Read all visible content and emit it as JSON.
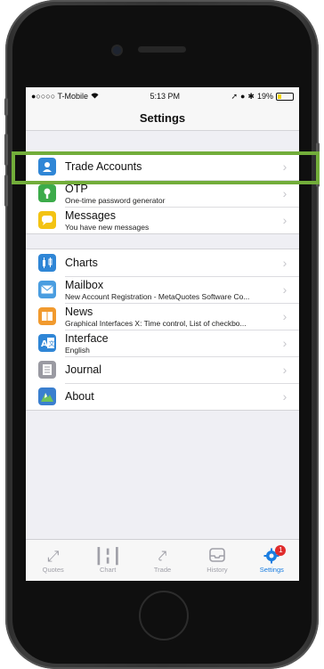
{
  "status": {
    "carrier": "●○○○○ T-Mobile",
    "wifi": "wifi-icon",
    "time": "5:13 PM",
    "battery_text": "19%"
  },
  "nav": {
    "title": "Settings"
  },
  "group1": [
    {
      "icon": "trade-accounts-icon",
      "color": "#2f86d6",
      "label": "Trade Accounts",
      "sub": ""
    }
  ],
  "group2": [
    {
      "icon": "otp-lock-icon",
      "color": "#3cab4a",
      "label": "OTP",
      "sub": "One-time password generator"
    },
    {
      "icon": "messages-icon",
      "color": "#f3c313",
      "label": "Messages",
      "sub": "You have new messages"
    }
  ],
  "group3": [
    {
      "icon": "charts-icon",
      "color": "#2f86d6",
      "label": "Charts",
      "sub": ""
    },
    {
      "icon": "mailbox-icon",
      "color": "#4a9de0",
      "label": "Mailbox",
      "sub": "New Account Registration - MetaQuotes Software Co..."
    },
    {
      "icon": "news-icon",
      "color": "#f19a2e",
      "label": "News",
      "sub": "Graphical Interfaces X: Time control, List of checkbo..."
    },
    {
      "icon": "interface-language-icon",
      "color": "#2f86d6",
      "label": "Interface",
      "sub": "English"
    },
    {
      "icon": "journal-icon",
      "color": "#9a9aa2",
      "label": "Journal",
      "sub": ""
    },
    {
      "icon": "about-icon",
      "color": "#3a7fcf",
      "label": "About",
      "sub": ""
    }
  ],
  "tabs": [
    {
      "icon": "quotes-icon",
      "label": "Quotes"
    },
    {
      "icon": "chart-icon",
      "label": "Chart"
    },
    {
      "icon": "trade-icon",
      "label": "Trade"
    },
    {
      "icon": "history-icon",
      "label": "History"
    },
    {
      "icon": "settings-icon",
      "label": "Settings",
      "badge": "1"
    }
  ],
  "colors": {
    "accent": "#1a7de0",
    "highlight": "#72ad3a"
  }
}
